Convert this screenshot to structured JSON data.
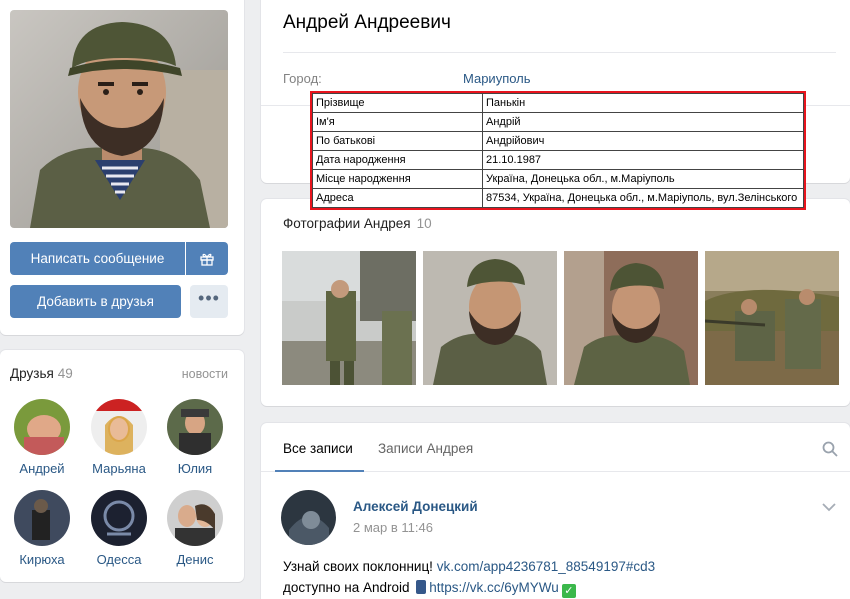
{
  "profile": {
    "name": "Андрей Андреевич",
    "city_label": "Город:",
    "city_value": "Мариуполь"
  },
  "actions": {
    "message_button": "Написать сообщение",
    "add_friend_button": "Добавить в друзья",
    "more_button": "•••"
  },
  "friends": {
    "title": "Друзья",
    "count": "49",
    "news_link": "новости",
    "items": [
      {
        "name": "Андрей"
      },
      {
        "name": "Марьяна"
      },
      {
        "name": "Юлия"
      },
      {
        "name": "Кирюха"
      },
      {
        "name": "Одесса"
      },
      {
        "name": "Денис"
      }
    ]
  },
  "overlay_table": {
    "rows": [
      {
        "key": "Прізвище",
        "value": "Панькін"
      },
      {
        "key": "Ім'я",
        "value": "Андрій"
      },
      {
        "key": "По батькові",
        "value": "Андрійович"
      },
      {
        "key": "Дата народження",
        "value": "21.10.1987"
      },
      {
        "key": "Місце народження",
        "value": "Україна, Донецька обл., м.Маріуполь"
      },
      {
        "key": "Адреса",
        "value": "87534, Україна, Донецька обл., м.Маріуполь, вул.Зелінського"
      }
    ],
    "border_color": "#e8141d"
  },
  "photos": {
    "title": "Фотографии Андрея",
    "count": "10"
  },
  "wall": {
    "tabs": [
      "Все записи",
      "Записи Андрея"
    ],
    "post": {
      "author": "Алексей Донецкий",
      "date": "2 мар в 11:46",
      "line1_text": "Узнай своих поклонниц! ",
      "line1_link": "vk.com/app4236781_88549197#cd3",
      "line2_text": "доступно на Android ",
      "line2_link": "https://vk.cc/6yMYWu"
    }
  },
  "colors": {
    "accent": "#5181b8",
    "link": "#2a5885",
    "background": "#edeef0"
  }
}
